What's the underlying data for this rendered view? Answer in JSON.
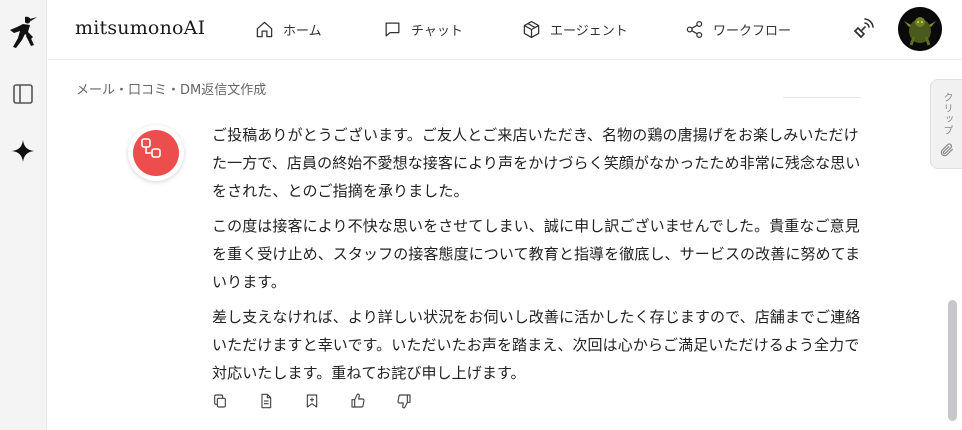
{
  "header": {
    "brand": "mitsumonoAI",
    "nav": [
      {
        "label": "ホーム",
        "icon": "home-icon"
      },
      {
        "label": "チャット",
        "icon": "chat-icon"
      },
      {
        "label": "エージェント",
        "icon": "cube-icon"
      },
      {
        "label": "ワークフロー",
        "icon": "share-icon"
      }
    ]
  },
  "page": {
    "title": "メール・口コミ・DM返信文作成"
  },
  "clip_tab": {
    "label": "クリップ"
  },
  "message": {
    "paragraphs": [
      "ご投稿ありがとうございます。ご友人とご来店いただき、名物の鶏の唐揚げをお楽しみいただけた一方で、店員の終始不愛想な接客により声をかけづらく笑顔がなかったため非常に残念な思いをされた、とのご指摘を承りました。",
      "この度は接客により不快な思いをさせてしまい、誠に申し訳ございませんでした。貴重なご意見を重く受け止め、スタッフの接客態度について教育と指導を徹底し、サービスの改善に努めてまいります。",
      "差し支えなければ、より詳しい状況をお伺いし改善に活かしたく存じますので、店舗までご連絡いただけますと幸いです。いただいたお声を踏まえ、次回は心からご満足いただけるよう全力で対応いたします。重ねてお詫び申し上げます。"
    ],
    "actions": [
      "copy-icon",
      "document-icon",
      "bookmark-icon",
      "thumbs-up-icon",
      "thumbs-down-icon"
    ]
  },
  "colors": {
    "bot_avatar": "#ec4d4d",
    "rail_bg": "#f4f4f5"
  }
}
